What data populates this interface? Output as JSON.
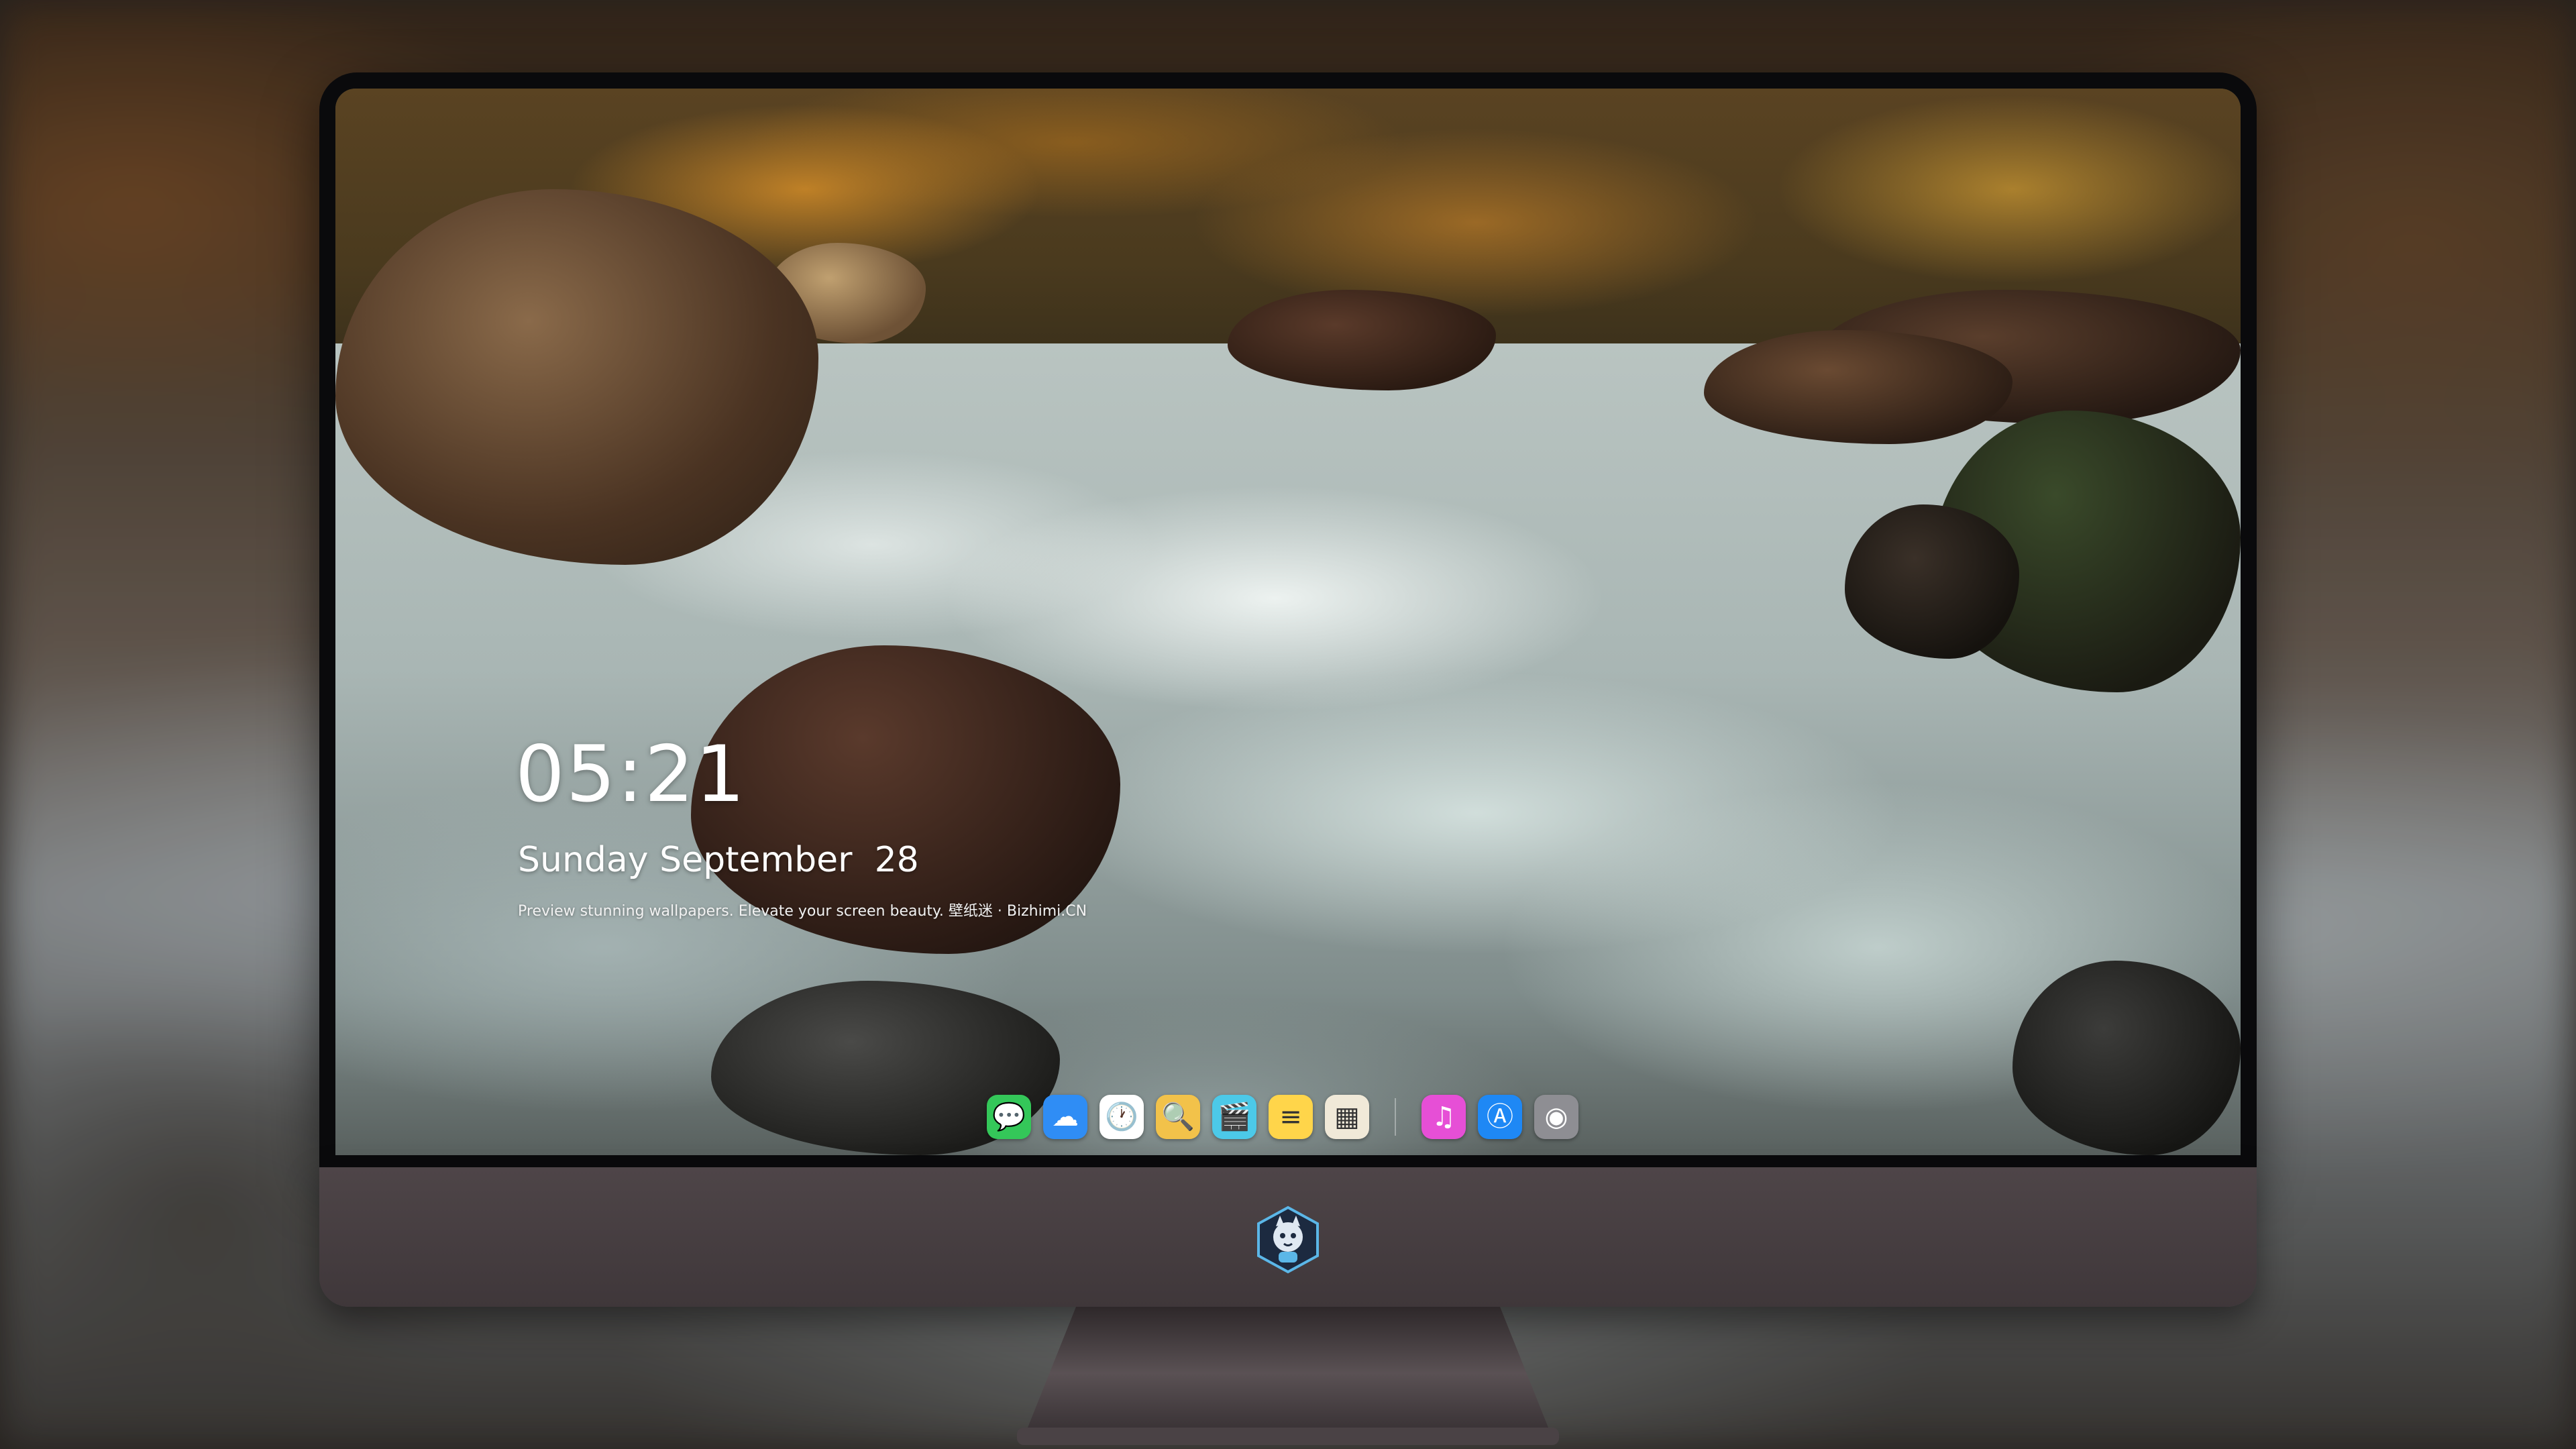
{
  "lockscreen": {
    "time": "05:21",
    "date": "Sunday September  28",
    "tagline": "Preview stunning wallpapers. Elevate your screen beauty. 壁纸迷 · Bizhimi.CN"
  },
  "dock": {
    "apps": [
      {
        "name": "messages-icon",
        "glyph": "💬",
        "bg": "#34c759"
      },
      {
        "name": "weather-icon",
        "glyph": "☁",
        "bg": "#2f8df5"
      },
      {
        "name": "clock-icon",
        "glyph": "🕐",
        "bg": "#ffffff"
      },
      {
        "name": "preview-icon",
        "glyph": "🔍",
        "bg": "#f2c24a"
      },
      {
        "name": "clapper-icon",
        "glyph": "🎬",
        "bg": "#4cc9e8"
      },
      {
        "name": "notes-icon",
        "glyph": "≡",
        "bg": "#ffd54a"
      },
      {
        "name": "photo-browser-icon",
        "glyph": "▦",
        "bg": "#f0e9d8"
      },
      {
        "name": "itunes-icon",
        "glyph": "♫",
        "bg": "#e64fd6"
      },
      {
        "name": "app-store-icon",
        "glyph": "Ⓐ",
        "bg": "#1e88f5"
      },
      {
        "name": "camera-icon",
        "glyph": "◉",
        "bg": "#8e8e93"
      }
    ]
  },
  "colors": {
    "chin": "#4e4548",
    "bezel": "#0a0a0c",
    "stand": "#4a4245"
  }
}
